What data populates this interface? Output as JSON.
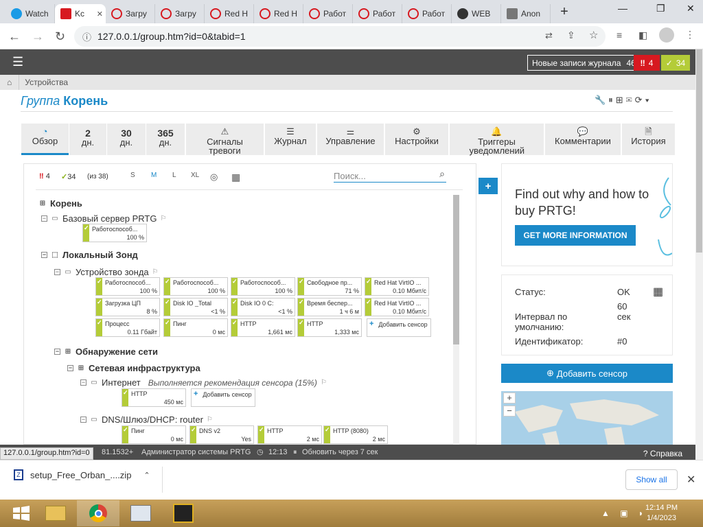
{
  "browser": {
    "tabs": [
      {
        "label": "Watch",
        "color": "#1a9be6"
      },
      {
        "label": "Kc",
        "color": "#d71920"
      },
      {
        "label": "Загру",
        "color": "#d71920"
      },
      {
        "label": "Загру",
        "color": "#d71920"
      },
      {
        "label": "Red H",
        "color": "#d71920"
      },
      {
        "label": "Red H",
        "color": "#d71920"
      },
      {
        "label": "Работ",
        "color": "#d71920"
      },
      {
        "label": "Работ",
        "color": "#d71920"
      },
      {
        "label": "Работ",
        "color": "#d71920"
      },
      {
        "label": "WEB",
        "color": "#333333"
      },
      {
        "label": "Anon",
        "color": "#555555"
      }
    ],
    "new_tab": "+",
    "url": "127.0.0.1/group.htm?id=0&tabid=1"
  },
  "header": {
    "new_log_label": "Новые записи журнала",
    "new_log_count": "46",
    "errors": "4",
    "ok": "34"
  },
  "breadcrumb": "Устройства",
  "title": {
    "prefix": "Группа",
    "name": "Корень"
  },
  "tabs": [
    {
      "big": "",
      "label": "Обзор",
      "icon": "gauge-icon"
    },
    {
      "big": "2",
      "label": "дн."
    },
    {
      "big": "30",
      "label": "дн."
    },
    {
      "big": "365",
      "label": "дн."
    },
    {
      "big": "",
      "label": "Сигналы тревоги",
      "icon": "warning-icon"
    },
    {
      "big": "",
      "label": "Журнал",
      "icon": "log-icon"
    },
    {
      "big": "",
      "label": "Управление",
      "icon": "sliders-icon"
    },
    {
      "big": "",
      "label": "Настройки",
      "icon": "gear-icon"
    },
    {
      "big": "",
      "label": "Триггеры уведомлений",
      "icon": "bell-icon"
    },
    {
      "big": "",
      "label": "Комментарии",
      "icon": "comment-icon"
    },
    {
      "big": "",
      "label": "История",
      "icon": "history-icon"
    }
  ],
  "toolbar": {
    "errors": "4",
    "ok": "34",
    "total": "(из 38)",
    "sizes": [
      "S",
      "M",
      "L",
      "XL"
    ],
    "search_placeholder": "Поиск..."
  },
  "tree": {
    "root": "Корень",
    "base_server": "Базовый сервер PRTG",
    "base_sensors": [
      {
        "name": "Работоспособ...",
        "value": "100 %"
      }
    ],
    "local_probe": "Локальный Зонд",
    "probe_device": "Устройство зонда",
    "probe_sensors": [
      {
        "name": "Работоспособ...",
        "value": "100 %"
      },
      {
        "name": "Работоспособ...",
        "value": "100 %"
      },
      {
        "name": "Работоспособ...",
        "value": "100 %"
      },
      {
        "name": "Свободное пр...",
        "value": "71 %"
      },
      {
        "name": "Red Hat VirtIO ...",
        "value": "0.10 Мбит/с"
      },
      {
        "name": "Загрузка ЦП",
        "value": "8 %"
      },
      {
        "name": "Disk IO _Total",
        "value": "<1 %"
      },
      {
        "name": "Disk IO 0 C:",
        "value": "<1 %"
      },
      {
        "name": "Время беспер...",
        "value": "1 ч 6 м"
      },
      {
        "name": "Red Hat VirtIO ...",
        "value": "0.10 Мбит/с"
      },
      {
        "name": "Процесс",
        "value": "0.11 Гбайт"
      },
      {
        "name": "Пинг",
        "value": "0 мс"
      },
      {
        "name": "HTTP",
        "value": "1,661 мс"
      },
      {
        "name": "HTTP",
        "value": "1,333 мс"
      }
    ],
    "add_sensor": "Добавить сенсор",
    "discovery": "Обнаружение сети",
    "net_infra": "Сетевая инфраструктура",
    "internet": "Интернет",
    "internet_rec": "Выполняется рекомендация сенсора (15%)",
    "internet_sensors": [
      {
        "name": "HTTP",
        "value": "450 мс"
      }
    ],
    "dns": "DNS/Шлюз/DHCP: router",
    "dns_sensors": [
      {
        "name": "Пинг",
        "value": "0 мс"
      },
      {
        "name": "DNS v2",
        "value": "Yes"
      },
      {
        "name": "HTTP",
        "value": "2 мс"
      },
      {
        "name": "HTTP (8080)",
        "value": "2 мс"
      }
    ]
  },
  "promo": {
    "text": "Find out why and how to buy PRTG!",
    "button": "GET MORE INFORMATION"
  },
  "status": {
    "status_label": "Статус:",
    "status_value": "OK",
    "interval_label": "Интервал по умолчанию:",
    "interval_value": "60 сек",
    "id_label": "Идентификатор:",
    "id_value": "#0"
  },
  "add_sensor_button": "Добавить сенсор",
  "footer": {
    "url_tip": "127.0.0.1/group.htm?id=0",
    "version": "81.1532+",
    "user": "Администратор системы PRTG",
    "time": "12:13",
    "refresh": "Обновить через 7 сек",
    "help": "Справка"
  },
  "download": {
    "file": "setup_Free_Orban_....zip",
    "show_all": "Show all"
  },
  "taskbar": {
    "time": "12:14 PM",
    "date": "1/4/2023"
  }
}
